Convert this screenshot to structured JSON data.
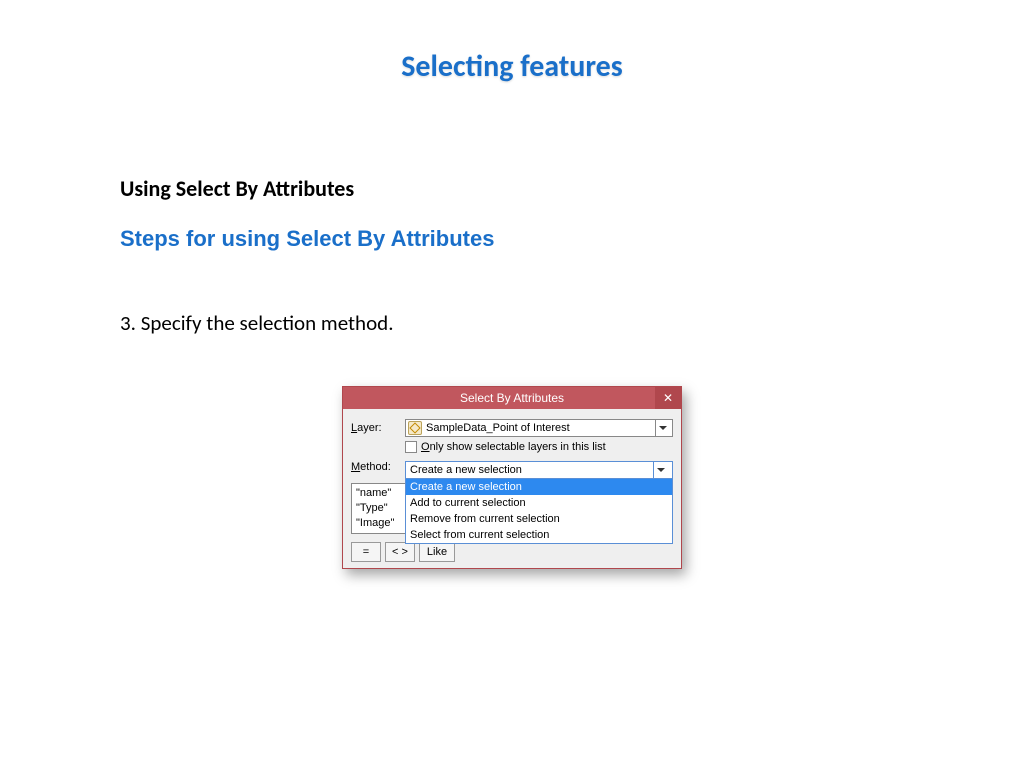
{
  "page": {
    "title": "Selecting features",
    "heading1": "Using Select By Attributes",
    "heading2": "Steps for using Select By Attributes",
    "step": "3. Specify the selection method."
  },
  "dialog": {
    "title": "Select By Attributes",
    "layer_label": "Layer:",
    "layer_value": "SampleData_Point of Interest",
    "only_selectable": "Only show selectable layers in this list",
    "method_label": "Method:",
    "method_value": "Create a new selection",
    "method_options": {
      "o0": "Create a new selection",
      "o1": "Add to current selection",
      "o2": "Remove from current selection",
      "o3": "Select from current selection"
    },
    "fields": {
      "f0": "\"name\"",
      "f1": "\"Type\"",
      "f2": "\"Image\""
    },
    "buttons": {
      "eq": "=",
      "ne": "< >",
      "like": "Like"
    }
  }
}
